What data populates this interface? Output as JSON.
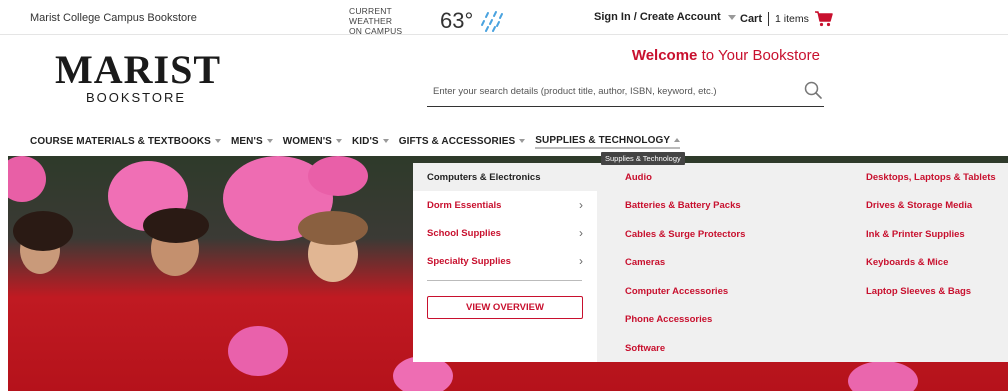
{
  "topbar": {
    "store_name": "Marist College Campus Bookstore",
    "weather_label_line1": "CURRENT WEATHER",
    "weather_label_line2": "ON CAMPUS",
    "weather_temp": "63°",
    "weather_icon": "rain-icon",
    "signin_label": "Sign In / Create Account",
    "cart_label": "Cart",
    "cart_count": "1 items",
    "cart_icon": "cart-icon"
  },
  "header": {
    "logo_main": "MARIST",
    "logo_sub": "BOOKSTORE",
    "welcome_bold": "Welcome",
    "welcome_rest": " to Your Bookstore",
    "search_placeholder": "Enter your search details (product title, author, ISBN, keyword, etc.)"
  },
  "nav": {
    "items": [
      {
        "label": "COURSE MATERIALS & TEXTBOOKS"
      },
      {
        "label": "MEN'S"
      },
      {
        "label": "WOMEN'S"
      },
      {
        "label": "KID'S"
      },
      {
        "label": "GIFTS & ACCESSORIES"
      },
      {
        "label": "SUPPLIES & TECHNOLOGY"
      }
    ],
    "tooltip": "Supplies & Technology"
  },
  "menu": {
    "categories": [
      {
        "label": "Computers & Electronics"
      },
      {
        "label": "Dorm Essentials"
      },
      {
        "label": "School Supplies"
      },
      {
        "label": "Specialty Supplies"
      }
    ],
    "view_overview": "VIEW OVERVIEW",
    "links_col1": [
      "Audio",
      "Batteries & Battery Packs",
      "Cables & Surge Protectors",
      "Cameras",
      "Computer Accessories",
      "Phone Accessories",
      "Software"
    ],
    "links_col2": [
      "Desktops, Laptops & Tablets",
      "Drives & Storage Media",
      "Ink & Printer Supplies",
      "Keyboards & Mice",
      "Laptop Sleeves & Bags"
    ]
  },
  "colors": {
    "brand_red": "#c8102e",
    "menu_gray": "#f0f0f0"
  }
}
